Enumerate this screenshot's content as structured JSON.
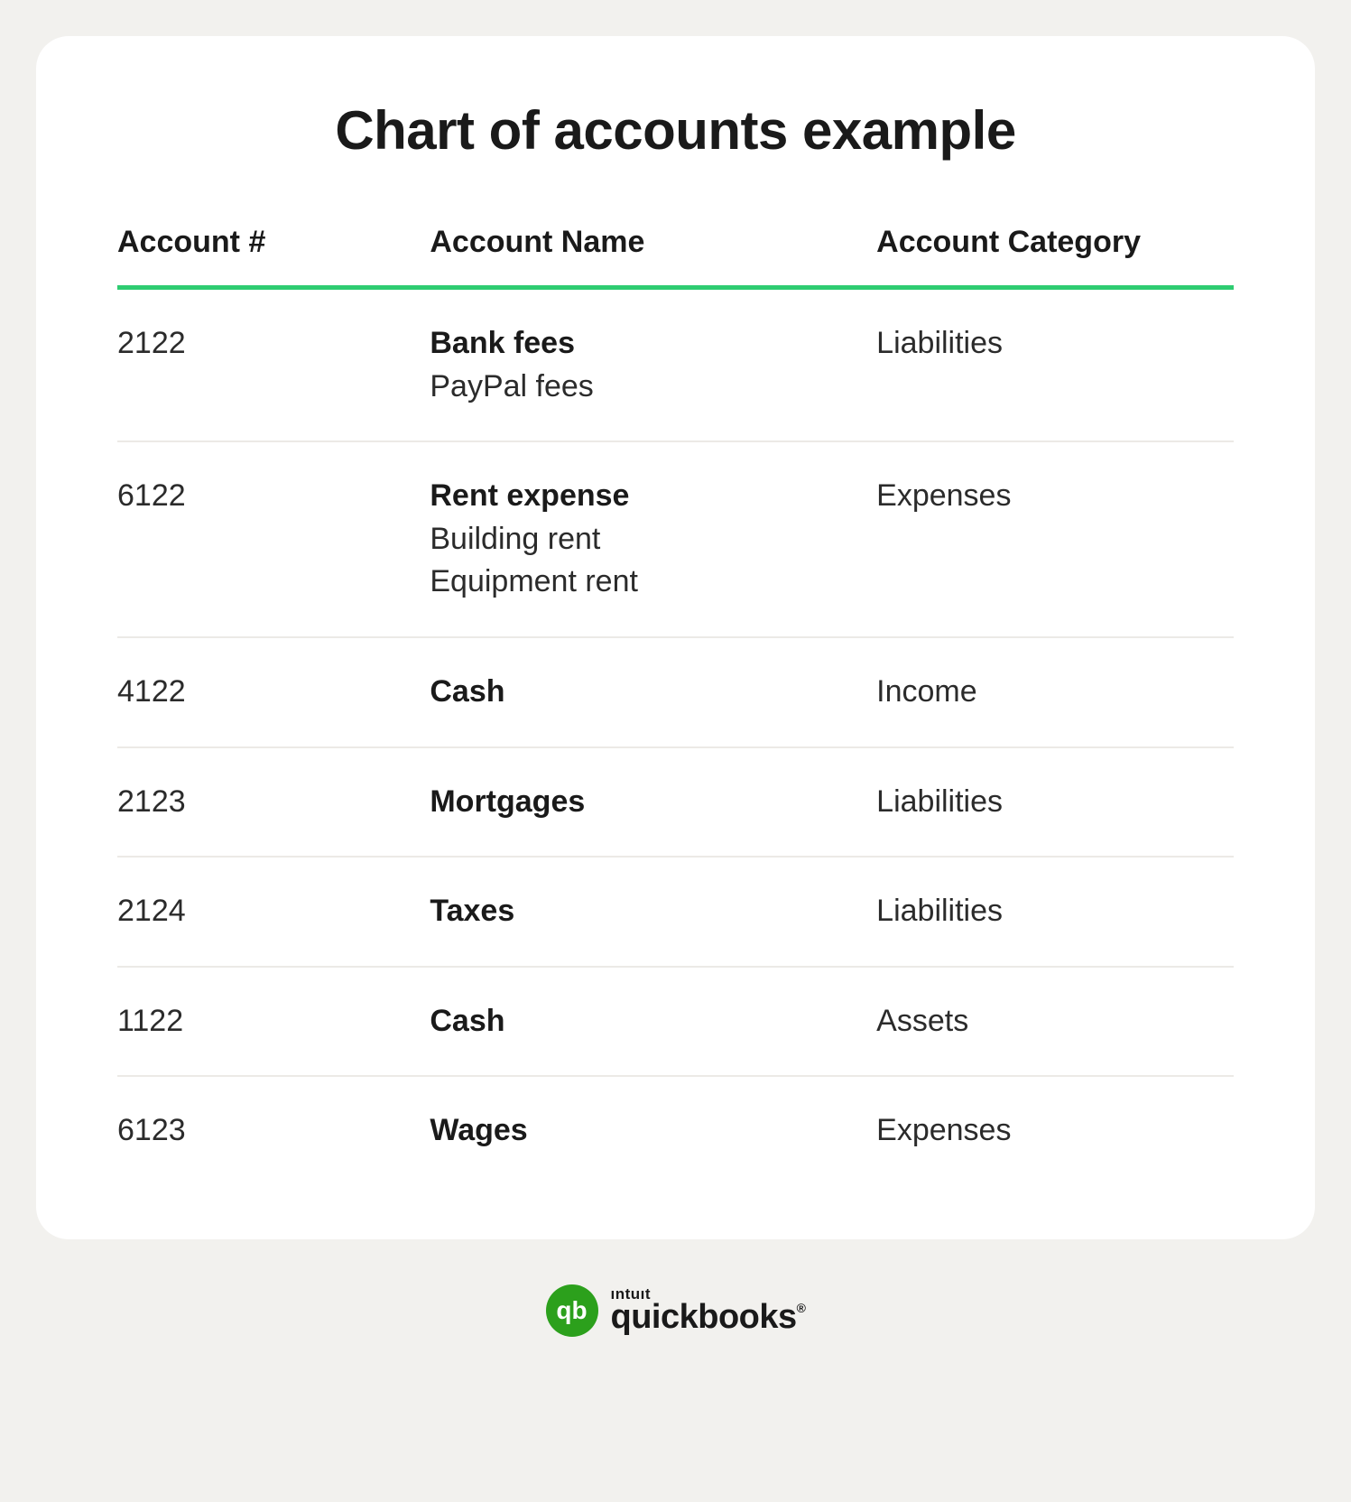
{
  "title": "Chart of accounts example",
  "columns": {
    "num": "Account #",
    "name": "Account Name",
    "cat": "Account Category"
  },
  "rows": [
    {
      "num": "2122",
      "name": "Bank fees",
      "subs": [
        "PayPal fees"
      ],
      "cat": "Liabilities"
    },
    {
      "num": "6122",
      "name": "Rent expense",
      "subs": [
        "Building rent",
        "Equipment rent"
      ],
      "cat": "Expenses"
    },
    {
      "num": "4122",
      "name": "Cash",
      "subs": [],
      "cat": "Income"
    },
    {
      "num": "2123",
      "name": "Mortgages",
      "subs": [],
      "cat": "Liabilities"
    },
    {
      "num": "2124",
      "name": "Taxes",
      "subs": [],
      "cat": "Liabilities"
    },
    {
      "num": "1122",
      "name": "Cash",
      "subs": [],
      "cat": "Assets"
    },
    {
      "num": "6123",
      "name": "Wages",
      "subs": [],
      "cat": "Expenses"
    }
  ],
  "brand": {
    "icon_text": "qb",
    "top": "ıntuıt",
    "bottom": "quickbooks",
    "reg": "®"
  },
  "colors": {
    "accent": "#2ecc71",
    "brand_green": "#2ca01c"
  }
}
